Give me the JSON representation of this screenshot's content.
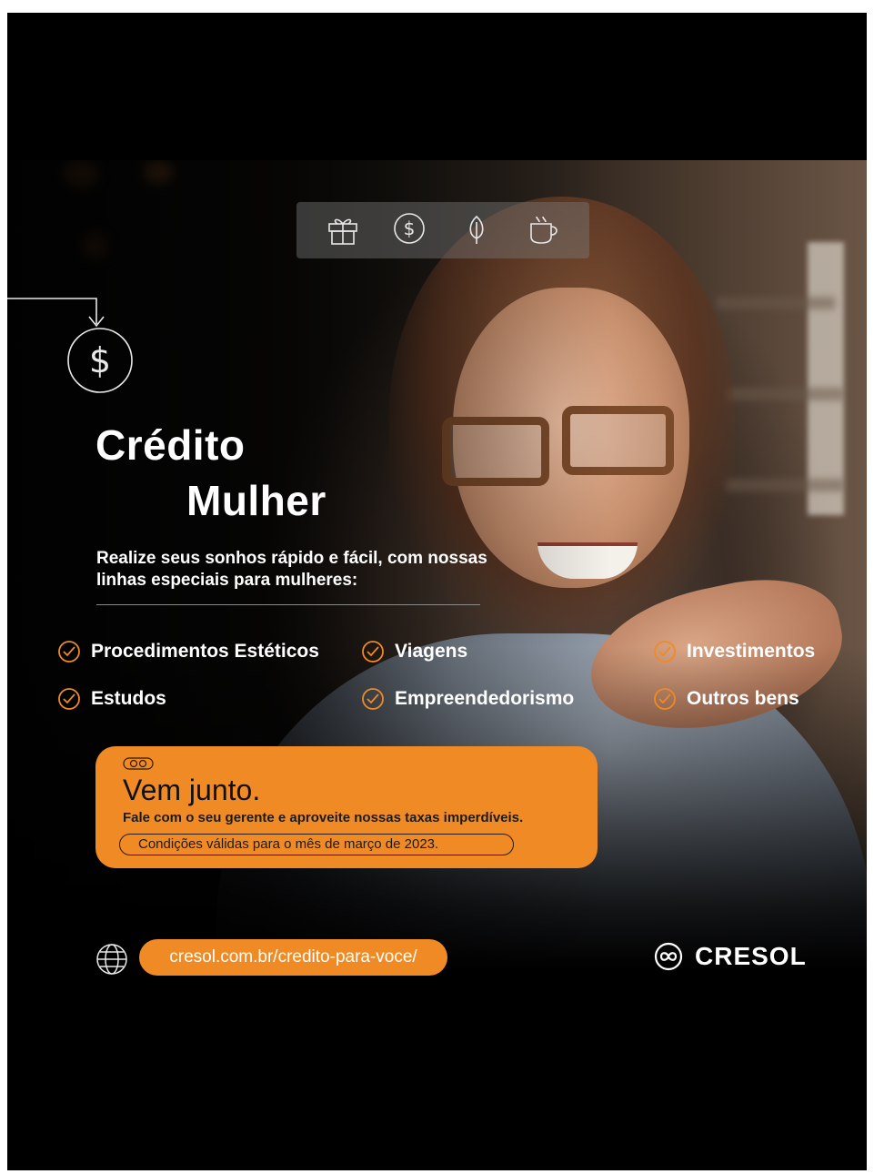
{
  "ad": {
    "title_line1": "Crédito",
    "title_line2": "Mulher",
    "subtitle": "Realize seus sonhos rápido e fácil, com nossas linhas especiais para mulheres:",
    "categories": [
      "Procedimentos Estéticos",
      "Viagens",
      "Investimentos",
      "Estudos",
      "Empreendedorismo",
      "Outros bens"
    ],
    "card": {
      "title": "Vem junto.",
      "text": "Fale com o seu gerente e aproveite nossas taxas imperdíveis.",
      "conditions": "Condições válidas para o mês de março de 2023."
    },
    "url": "cresol.com.br/credito-para-voce/",
    "brand": "CRESOL"
  },
  "colors": {
    "accent": "#f08a24",
    "background": "#000000",
    "text": "#ffffff"
  },
  "icons": [
    "gift-icon",
    "dollar-coin-icon",
    "leaf-icon",
    "coffee-cup-icon",
    "globe-icon",
    "check-circle-icon",
    "cresol-logo-icon"
  ]
}
